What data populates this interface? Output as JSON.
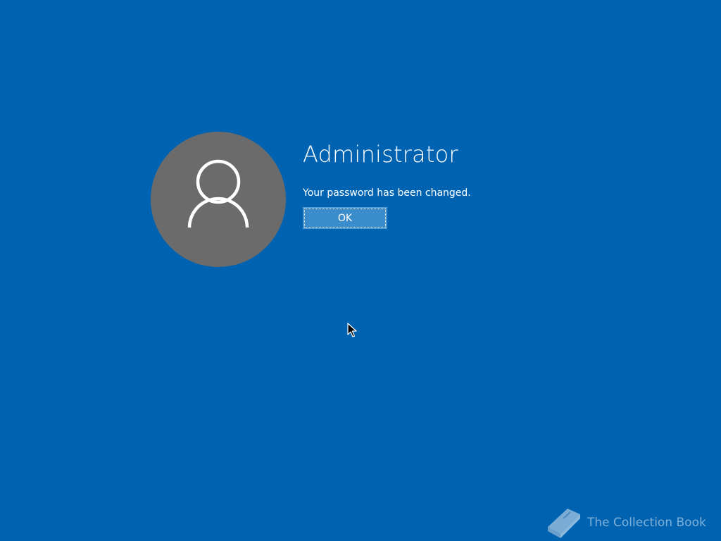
{
  "account": {
    "user_name": "Administrator",
    "avatar_icon": "user-silhouette-icon"
  },
  "dialog": {
    "message": "Your password has been changed.",
    "ok_label": "OK"
  },
  "watermark": {
    "icon": "book-icon",
    "text": "The Collection Book"
  },
  "colors": {
    "background": "#0063b1",
    "avatar_circle": "#6b6b6b",
    "button": "#3b8ccb",
    "text": "#ffffff"
  }
}
